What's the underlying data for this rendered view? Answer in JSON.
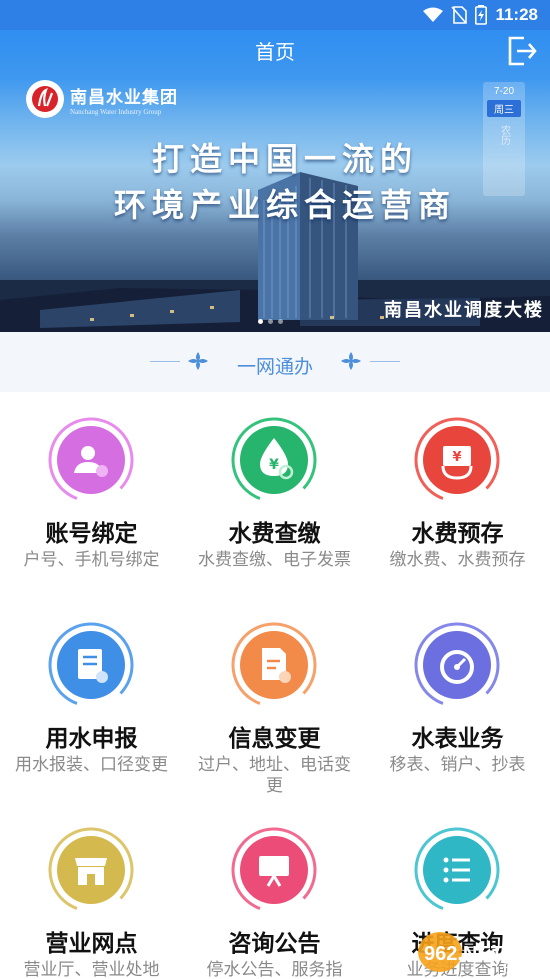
{
  "status_bar": {
    "time": "11:28",
    "icons": [
      "wifi-icon",
      "no-sim-icon",
      "battery-charging-icon"
    ]
  },
  "header": {
    "title": "首页",
    "logout_icon": "logout-icon"
  },
  "banner": {
    "logo_name": "南昌水业集团",
    "logo_name_en": "Nanchang Water Industry Group",
    "slogan_line1": "打造中国一流的",
    "slogan_line2": "环境产业综合运营商",
    "caption": "南昌水业调度大楼",
    "calendar": {
      "date": "7-20",
      "weekday": "周三",
      "lunar": "农历"
    },
    "slides_count": 3,
    "active_slide": 1
  },
  "section": {
    "title": "一网通办"
  },
  "services": [
    {
      "title": "账号绑定",
      "desc": "户号、手机号绑定",
      "icon": "account-bind-icon",
      "color": "#d56ee0",
      "ring": "#e78cec"
    },
    {
      "title": "水费查缴",
      "desc": "水费查缴、电子发票",
      "icon": "water-fee-query-icon",
      "color": "#27b46c",
      "ring": "#35c27c"
    },
    {
      "title": "水费预存",
      "desc": "缴水费、水费预存",
      "icon": "water-fee-prepay-icon",
      "color": "#e8453c",
      "ring": "#f06058"
    },
    {
      "title": "用水申报",
      "desc": "用水报装、口径变更",
      "icon": "water-apply-icon",
      "color": "#3f8fe6",
      "ring": "#5aa2ee"
    },
    {
      "title": "信息变更",
      "desc": "过户、地址、电话变更",
      "icon": "info-change-icon",
      "color": "#f28a4a",
      "ring": "#f6a06a"
    },
    {
      "title": "水表业务",
      "desc": "移表、销户、抄表",
      "icon": "water-meter-icon",
      "color": "#6b6fe0",
      "ring": "#8588ea"
    },
    {
      "title": "营业网点",
      "desc": "营业厅、营业处地",
      "icon": "service-outlet-icon",
      "color": "#d4b94e",
      "ring": "#dcc56a"
    },
    {
      "title": "咨询公告",
      "desc": "停水公告、服务指",
      "icon": "announcement-icon",
      "color": "#ec4d78",
      "ring": "#f26a90"
    },
    {
      "title": "进度查询",
      "desc": "业务进度查询",
      "icon": "progress-query-icon",
      "color": "#2fb7c6",
      "ring": "#4cc6d3"
    }
  ],
  "watermark": {
    "text": "962.NET",
    "subtext": "乐游网"
  }
}
